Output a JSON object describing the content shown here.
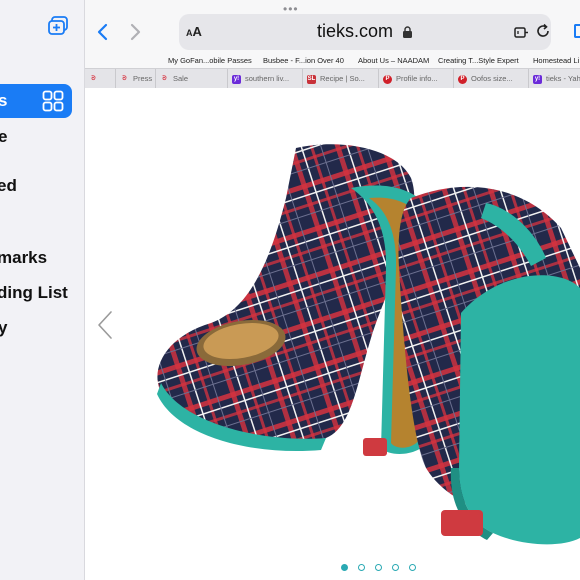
{
  "browser": {
    "url_display": "tieks.com",
    "text_size_button": "AA"
  },
  "sidebar": {
    "items": [
      {
        "label": "Tabs",
        "active": true
      },
      {
        "label": "Private"
      },
      {
        "label": "Shared"
      },
      {
        "label": "Bookmarks"
      },
      {
        "label": "Reading List"
      },
      {
        "label": "History"
      }
    ],
    "visible_fragments": [
      "s",
      "e",
      "ed",
      "marks",
      "ding List",
      "y"
    ]
  },
  "favorites": [
    "My GoFan...obile Passes",
    "Busbee - F...ion Over 40",
    "About Us – NAADAM",
    "Creating T...Style Expert",
    "Homestead Li"
  ],
  "tabs": [
    {
      "label": "",
      "icon": "tieks-favicon"
    },
    {
      "label": "Press",
      "icon": "tieks-favicon"
    },
    {
      "label": "Sale",
      "icon": "tieks-favicon"
    },
    {
      "label": "southern liv...",
      "icon": "yahoo-favicon"
    },
    {
      "label": "Recipe | So...",
      "icon": "southern-living-favicon"
    },
    {
      "label": "Profile info...",
      "icon": "pinterest-favicon"
    },
    {
      "label": "Oofos size...",
      "icon": "pinterest-favicon"
    },
    {
      "label": "tieks - Yah",
      "icon": "yahoo-favicon"
    }
  ],
  "carousel": {
    "slide_count": 5,
    "active_index": 0
  },
  "colors": {
    "accent": "#1a7cf5",
    "tieks_teal": "#2aa9b3",
    "plaid_navy": "#22294a",
    "plaid_red": "#d6323f",
    "sole_teal": "#2db3a4"
  }
}
